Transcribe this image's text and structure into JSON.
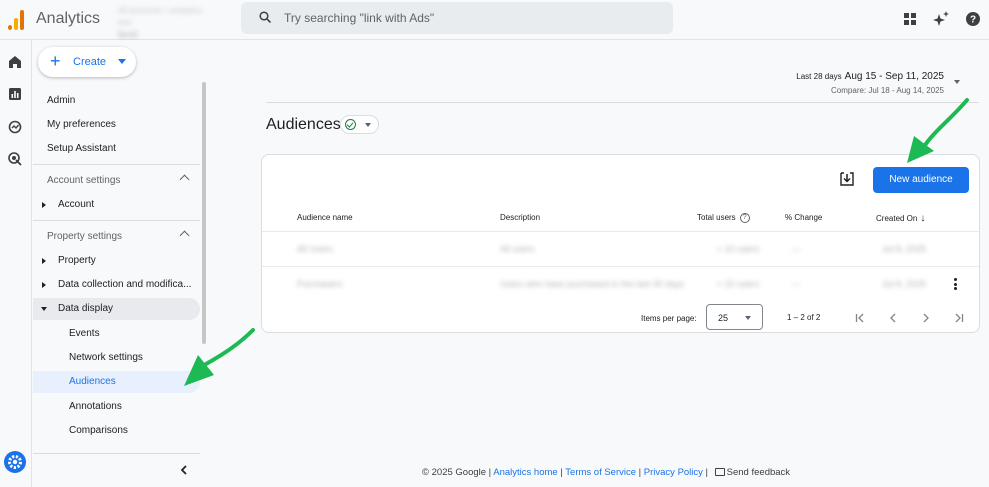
{
  "header": {
    "app_title": "Analytics",
    "account_line": "All accounts > analytics-test",
    "property_name": "test",
    "search_placeholder": "Try searching \"link with Ads\""
  },
  "sidebar": {
    "create_label": "Create",
    "top_items": [
      "Admin",
      "My preferences",
      "Setup Assistant"
    ],
    "account_section": {
      "label": "Account settings",
      "items": [
        "Account"
      ]
    },
    "property_section": {
      "label": "Property settings",
      "items": [
        "Property",
        "Data collection and modifica...",
        "Data display"
      ],
      "data_display_children": [
        "Events",
        "Network settings",
        "Audiences",
        "Annotations",
        "Comparisons"
      ]
    },
    "active_item": "Audiences"
  },
  "date_range": {
    "label": "Last 28 days",
    "range": "Aug 15 - Sep 11, 2025",
    "compare": "Compare: Jul 18 - Aug 14, 2025"
  },
  "main": {
    "title": "Audiences",
    "new_audience_label": "New audience",
    "columns": [
      "Audience name",
      "Description",
      "Total users",
      "% Change",
      "Created On"
    ],
    "rows": [
      {
        "name": "All Users",
        "description": "All users",
        "total_users": "< 10 users",
        "change": "—",
        "created": "Jul 8, 2025"
      },
      {
        "name": "Purchasers",
        "description": "Users who have purchased in the last 30 days",
        "total_users": "< 10 users",
        "change": "—",
        "created": "Jul 8, 2025"
      }
    ],
    "pagination": {
      "items_per_page_label": "Items per page:",
      "items_per_page": "25",
      "range": "1 – 2 of 2"
    }
  },
  "footer": {
    "copyright": "© 2025 Google |",
    "links": [
      "Analytics home",
      "Terms of Service",
      "Privacy Policy"
    ],
    "sep": "|",
    "feedback": "Send feedback"
  },
  "colors": {
    "accent": "#1a73e8",
    "active_bg": "#e8f0fe",
    "annotation_arrow": "#1db954"
  }
}
